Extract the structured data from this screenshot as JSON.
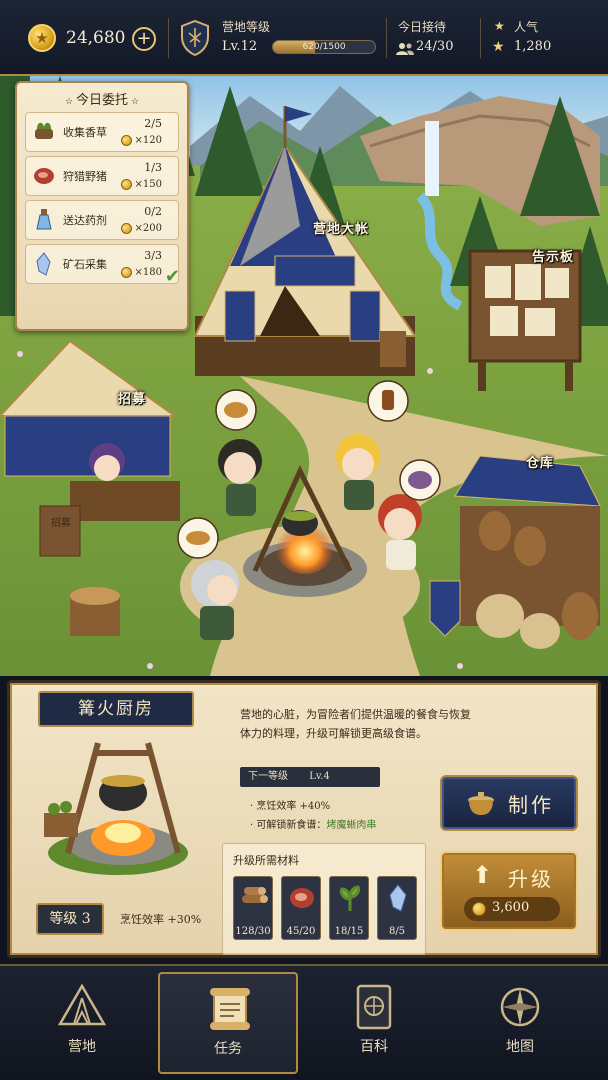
{
  "topbar": {
    "gold": "24,680",
    "camp_label": "营地等级",
    "camp_level": "Lv.12",
    "xp_text": "620/1500",
    "xp_progress": 0.413,
    "reception_label": "今日接待",
    "reception_value": "24/30",
    "popularity_label": "人气",
    "popularity_value": "1,280"
  },
  "scene": {
    "tent_label": "营地大帐",
    "board_label": "告示板",
    "recruit_label": "招募",
    "warehouse_label": "仓库",
    "sign_text": "招募"
  },
  "quests": {
    "title": "今日委托",
    "items": [
      {
        "name": "收集香草",
        "progress": "2/5",
        "reward": "×120",
        "icon": "herb-bundle-icon"
      },
      {
        "name": "狩猎野猪",
        "progress": "1/3",
        "reward": "×150",
        "icon": "meat-icon"
      },
      {
        "name": "送达药剂",
        "progress": "0/2",
        "reward": "×200",
        "icon": "potion-icon"
      },
      {
        "name": "矿石采集",
        "progress": "3/3",
        "reward": "×180",
        "icon": "crystal-icon",
        "completed": true
      }
    ]
  },
  "detail": {
    "building_name": "篝火厨房",
    "description": "营地的心脏，为冒险者们提供温暖的餐食与恢复体力的料理，升级可解锁更高级食谱。",
    "level_badge": "等级 3",
    "current_effect": "烹饪效率 +30%",
    "next_level_label": "下一等级",
    "next_level_value": "Lv.4",
    "bonus1": "· 烹饪效率 +40%",
    "bonus2_prefix": "· 可解锁新食谱：",
    "bonus2_recipe": "烤魔蜥肉串",
    "materials_title": "升级所需材料",
    "materials": [
      {
        "count": "128/30",
        "icon": "wood-log-icon"
      },
      {
        "count": "45/20",
        "icon": "meat-icon"
      },
      {
        "count": "18/15",
        "icon": "herb-icon"
      },
      {
        "count": "8/5",
        "icon": "crystal-icon"
      }
    ],
    "craft_label": "制作",
    "upgrade_label": "升级",
    "upgrade_cost": "3,600",
    "colors": {
      "accent_gold": "#b08a45",
      "navy": "#1f2a44",
      "recipe_green": "#3d7a2a"
    }
  },
  "nav": {
    "items": [
      {
        "label": "营地",
        "icon": "tent-icon"
      },
      {
        "label": "任务",
        "icon": "scroll-icon",
        "active": true
      },
      {
        "label": "百科",
        "icon": "book-icon"
      },
      {
        "label": "地图",
        "icon": "compass-icon"
      }
    ]
  }
}
